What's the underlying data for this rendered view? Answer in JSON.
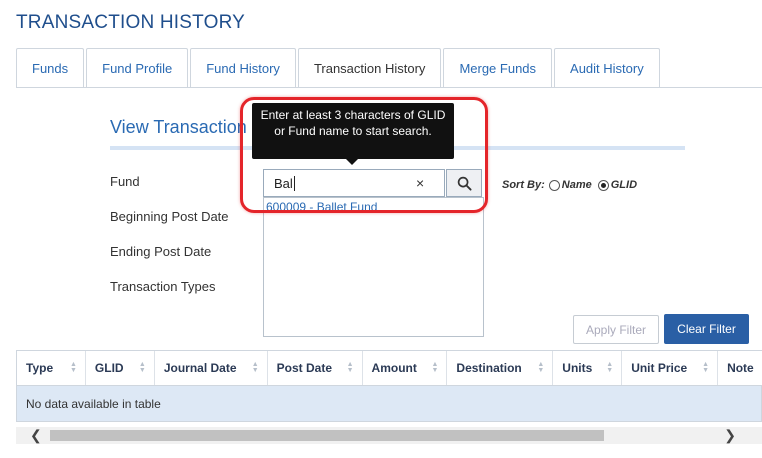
{
  "page": {
    "title": "TRANSACTION HISTORY"
  },
  "tabs": [
    {
      "label": "Funds"
    },
    {
      "label": "Fund Profile"
    },
    {
      "label": "Fund History"
    },
    {
      "label": "Transaction History",
      "active": true
    },
    {
      "label": "Merge Funds"
    },
    {
      "label": "Audit History"
    }
  ],
  "section": {
    "title": "View Transaction Histo"
  },
  "form": {
    "fund_label": "Fund",
    "begin_label": "Beginning Post Date",
    "end_label": "Ending Post Date",
    "types_label": "Transaction Types",
    "fund_value": "Bal",
    "clear_icon": "×",
    "search_icon": "search-icon",
    "result_item": "600009 - Ballet Fund",
    "tooltip": "Enter at least 3 characters of GLID or Fund name to start search."
  },
  "sortby": {
    "label": "Sort By:",
    "name_option": "Name",
    "glid_option": "GLID",
    "selected": "GLID"
  },
  "buttons": {
    "apply": "Apply Filter",
    "clear_filter": "Clear Filter"
  },
  "table": {
    "columns": [
      "Type",
      "GLID",
      "Journal Date",
      "Post Date",
      "Amount",
      "Destination",
      "Units",
      "Unit Price",
      "Note"
    ],
    "empty_message": "No data available in table"
  },
  "colors": {
    "accent": "#2a6ab3",
    "primary_button": "#2a5fa5",
    "highlight": "#e4252a"
  }
}
